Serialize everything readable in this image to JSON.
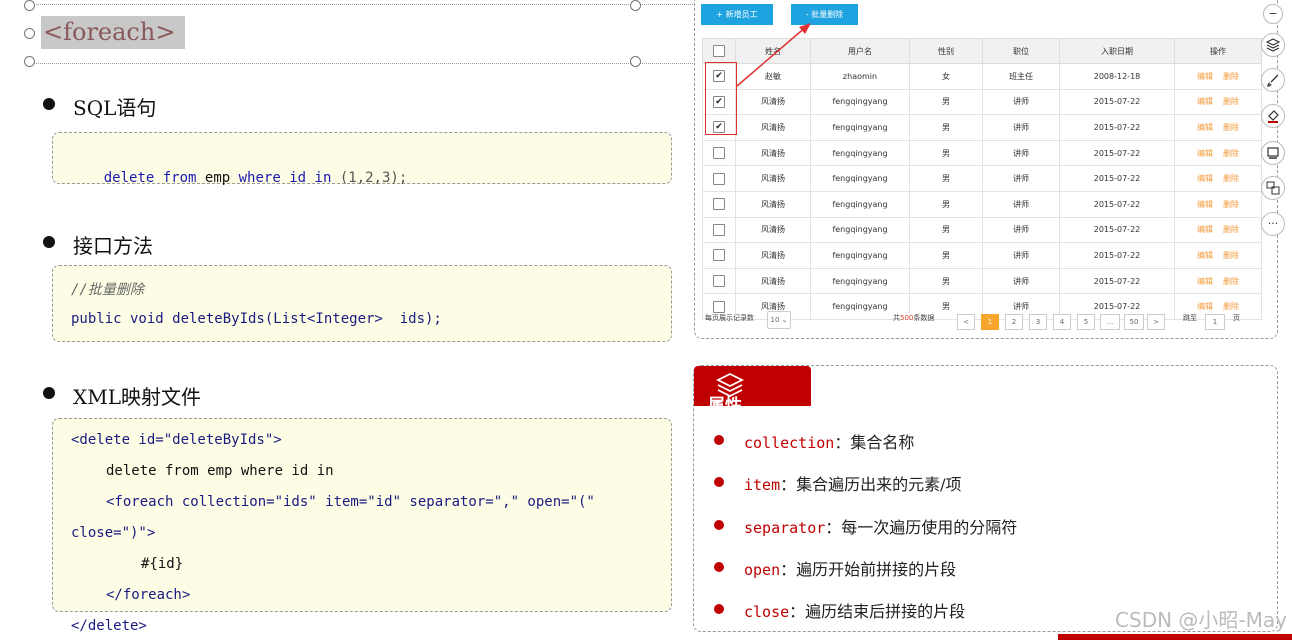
{
  "title": "<foreach>",
  "sections": [
    {
      "heading": "SQL语句"
    },
    {
      "heading": "接口方法"
    },
    {
      "heading": "XML映射文件"
    }
  ],
  "sql": {
    "kw1": "delete",
    "kw2": "from",
    "t": "emp",
    "kw3": "where",
    "f": "id",
    "kw4": "in",
    "vals": "(1,2,3);"
  },
  "iface": {
    "comment": "//批量删除",
    "sig": "public void deleteByIds(List<Integer>  ids);"
  },
  "xml": {
    "l1": "<delete id=\"deleteByIds\">",
    "l2": "delete from emp where id in",
    "l3": "<foreach collection=\"ids\" item=\"id\" separator=\",\" open=\"(\"",
    "l4": "close=\")\">",
    "l5": "#{id}",
    "l6": "</foreach>",
    "l7": "</delete>"
  },
  "table": {
    "add_button": "+ 新增员工",
    "batch_delete_button": "- 批量删除",
    "headers": [
      "",
      "姓名",
      "用户名",
      "性别",
      "职位",
      "入职日期",
      "操作"
    ],
    "rows": [
      {
        "checked": true,
        "name": "赵敏",
        "user": "zhaomin",
        "gender": "女",
        "job": "班主任",
        "date": "2008-12-18"
      },
      {
        "checked": true,
        "name": "风清扬",
        "user": "fengqingyang",
        "gender": "男",
        "job": "讲师",
        "date": "2015-07-22"
      },
      {
        "checked": true,
        "name": "风清扬",
        "user": "fengqingyang",
        "gender": "男",
        "job": "讲师",
        "date": "2015-07-22"
      },
      {
        "checked": false,
        "name": "风清扬",
        "user": "fengqingyang",
        "gender": "男",
        "job": "讲师",
        "date": "2015-07-22"
      },
      {
        "checked": false,
        "name": "风清扬",
        "user": "fengqingyang",
        "gender": "男",
        "job": "讲师",
        "date": "2015-07-22"
      },
      {
        "checked": false,
        "name": "风清扬",
        "user": "fengqingyang",
        "gender": "男",
        "job": "讲师",
        "date": "2015-07-22"
      },
      {
        "checked": false,
        "name": "风清扬",
        "user": "fengqingyang",
        "gender": "男",
        "job": "讲师",
        "date": "2015-07-22"
      },
      {
        "checked": false,
        "name": "风清扬",
        "user": "fengqingyang",
        "gender": "男",
        "job": "讲师",
        "date": "2015-07-22"
      },
      {
        "checked": false,
        "name": "风清扬",
        "user": "fengqingyang",
        "gender": "男",
        "job": "讲师",
        "date": "2015-07-22"
      },
      {
        "checked": false,
        "name": "风清扬",
        "user": "fengqingyang",
        "gender": "男",
        "job": "讲师",
        "date": "2015-07-22"
      }
    ],
    "op_edit": "编辑",
    "op_delete": "删除",
    "page_size_label": "每页展示记录数",
    "page_size": "10",
    "total_prefix": "共",
    "total": "500",
    "total_suffix": "条数据",
    "pages": [
      "<",
      "1",
      "2",
      "3",
      "4",
      "5",
      "...",
      "50",
      ">"
    ],
    "jump_label": "跳至",
    "jump_value": "1",
    "jump_suffix": "页"
  },
  "toolbar": {
    "icons": [
      "minus-icon",
      "layers-icon",
      "brush-icon",
      "eraser-icon",
      "screen-icon",
      "translate-icon",
      "more-icon"
    ],
    "more": "···",
    "minus": "−"
  },
  "props": {
    "tab_label": "属性",
    "items": [
      {
        "key": "collection",
        "desc": "：集合名称"
      },
      {
        "key": "item",
        "desc": "：集合遍历出来的元素/项"
      },
      {
        "key": "separator",
        "desc": "：每一次遍历使用的分隔符"
      },
      {
        "key": "open",
        "desc": "：遍历开始前拼接的片段"
      },
      {
        "key": "close",
        "desc": "：遍历结束后拼接的片段"
      }
    ]
  },
  "watermark": "CSDN @小昭-May",
  "colors": {
    "accent_red": "#c00000",
    "button_blue": "#1fa3e0",
    "code_bg": "#fdfde6"
  }
}
